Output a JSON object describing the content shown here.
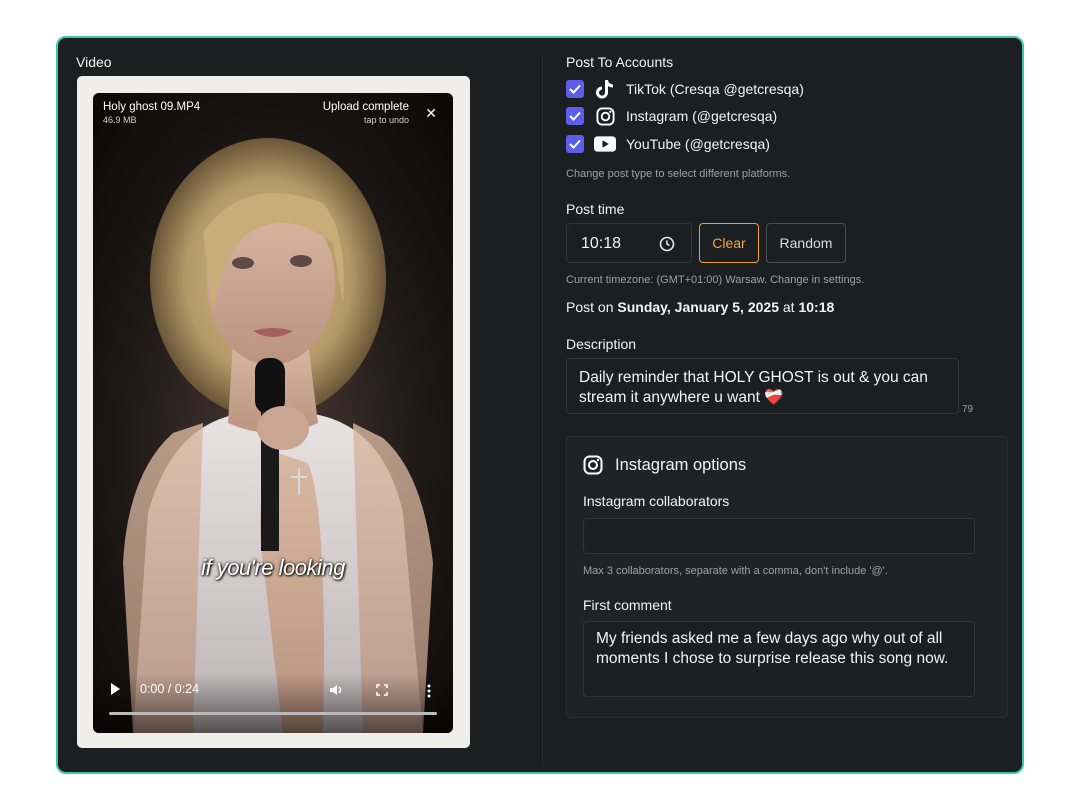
{
  "video": {
    "section_label": "Video",
    "file_name": "Holy ghost 09.MP4",
    "file_size": "46.9 MB",
    "upload_status": "Upload complete",
    "undo_text": "tap to undo",
    "close_icon": "close-icon",
    "caption": "if you're looking",
    "time": "0:00 / 0:24",
    "progress": 0
  },
  "accounts": {
    "title": "Post To Accounts",
    "items": [
      {
        "label": "TikTok (Cresqa @getcresqa)",
        "icon": "tiktok-icon",
        "checked": true
      },
      {
        "label": "Instagram (@getcresqa)",
        "icon": "instagram-icon",
        "checked": true
      },
      {
        "label": "YouTube (@getcresqa)",
        "icon": "youtube-icon",
        "checked": true
      }
    ],
    "hint": "Change post type to select different platforms."
  },
  "post_time": {
    "title": "Post time",
    "value": "10:18",
    "clear_label": "Clear",
    "random_label": "Random",
    "timezone_hint": "Current timezone: (GMT+01:00) Warsaw. Change in settings.",
    "post_on_prefix": "Post on ",
    "post_on_date": "Sunday, January 5, 2025",
    "post_on_mid": " at ",
    "post_on_time": "10:18"
  },
  "description": {
    "title": "Description",
    "text": "Daily reminder that HOLY GHOST is out & you can stream it anywhere u want",
    "emoji": "❤️‍🩹",
    "char_count": "79"
  },
  "instagram_options": {
    "title": "Instagram options",
    "collaborators_label": "Instagram collaborators",
    "collaborators_value": "",
    "collaborators_hint": "Max 3 collaborators, separate with a comma, don't include '@'.",
    "first_comment_label": "First comment",
    "first_comment_text": "My friends asked me a few days ago why out of all moments I chose to surprise release this song now."
  },
  "colors": {
    "accent_border": "#3fc5a9",
    "checkbox": "#5a5ee8",
    "clear_button": "#f0a63e",
    "panel_bg": "#1c1f21"
  }
}
